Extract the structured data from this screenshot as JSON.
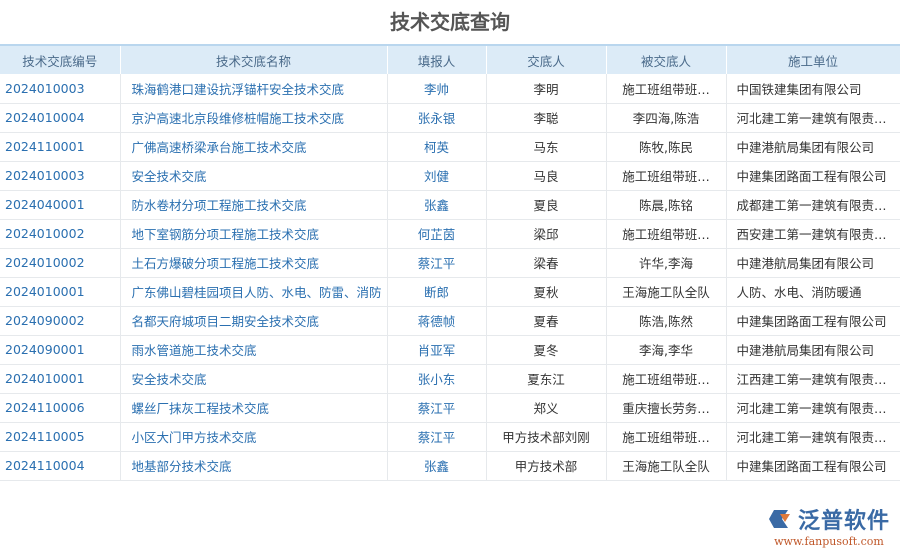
{
  "title": "技术交底查询",
  "columns": [
    "技术交底编号",
    "技术交底名称",
    "填报人",
    "交底人",
    "被交底人",
    "施工单位"
  ],
  "rows": [
    [
      "2024010003",
      "珠海鹤港口建设抗浮锚杆安全技术交底",
      "李帅",
      "李明",
      "施工班组带班…",
      "中国铁建集团有限公司"
    ],
    [
      "2024010004",
      "京沪高速北京段维修桩帽施工技术交底",
      "张永银",
      "李聪",
      "李四海,陈浩",
      "河北建工第一建筑有限责任…"
    ],
    [
      "2024110001",
      "广佛高速桥梁承台施工技术交底",
      "柯英",
      "马东",
      "陈牧,陈民",
      "中建港航局集团有限公司"
    ],
    [
      "2024010003",
      "安全技术交底",
      "刘健",
      "马良",
      "施工班组带班…",
      "中建集团路面工程有限公司"
    ],
    [
      "2024040001",
      "防水卷材分项工程施工技术交底",
      "张鑫",
      "夏良",
      "陈晨,陈铭",
      "成都建工第一建筑有限责任…"
    ],
    [
      "2024010002",
      "地下室钢筋分项工程施工技术交底",
      "何芷茵",
      "梁邱",
      "施工班组带班…",
      "西安建工第一建筑有限责任…"
    ],
    [
      "2024010002",
      "土石方爆破分项工程施工技术交底",
      "蔡江平",
      "梁春",
      "许华,李海",
      "中建港航局集团有限公司"
    ],
    [
      "2024010001",
      "广东佛山碧桂园项目人防、水电、防雷、消防",
      "断郎",
      "夏秋",
      "王海施工队全队",
      "人防、水电、消防暖通"
    ],
    [
      "2024090002",
      "名都天府城项目二期安全技术交底",
      "蒋德帧",
      "夏春",
      "陈浩,陈然",
      "中建集团路面工程有限公司"
    ],
    [
      "2024090001",
      "雨水管道施工技术交底",
      "肖亚军",
      "夏冬",
      "李海,李华",
      "中建港航局集团有限公司"
    ],
    [
      "2024010001",
      "安全技术交底",
      "张小东",
      "夏东江",
      "施工班组带班…",
      "江西建工第一建筑有限责任…"
    ],
    [
      "2024110006",
      "螺丝厂抹灰工程技术交底",
      "蔡江平",
      "郑义",
      "重庆擅长劳务…",
      "河北建工第一建筑有限责任…"
    ],
    [
      "2024110005",
      "小区大门甲方技术交底",
      "蔡江平",
      "甲方技术部刘刚",
      "施工班组带班…",
      "河北建工第一建筑有限责任…"
    ],
    [
      "2024110004",
      "地基部分技术交底",
      "张鑫",
      "甲方技术部",
      "王海施工队全队",
      "中建集团路面工程有限公司"
    ]
  ],
  "logo": {
    "cn": "泛普软件",
    "en": "www.fanpusoft.com"
  }
}
